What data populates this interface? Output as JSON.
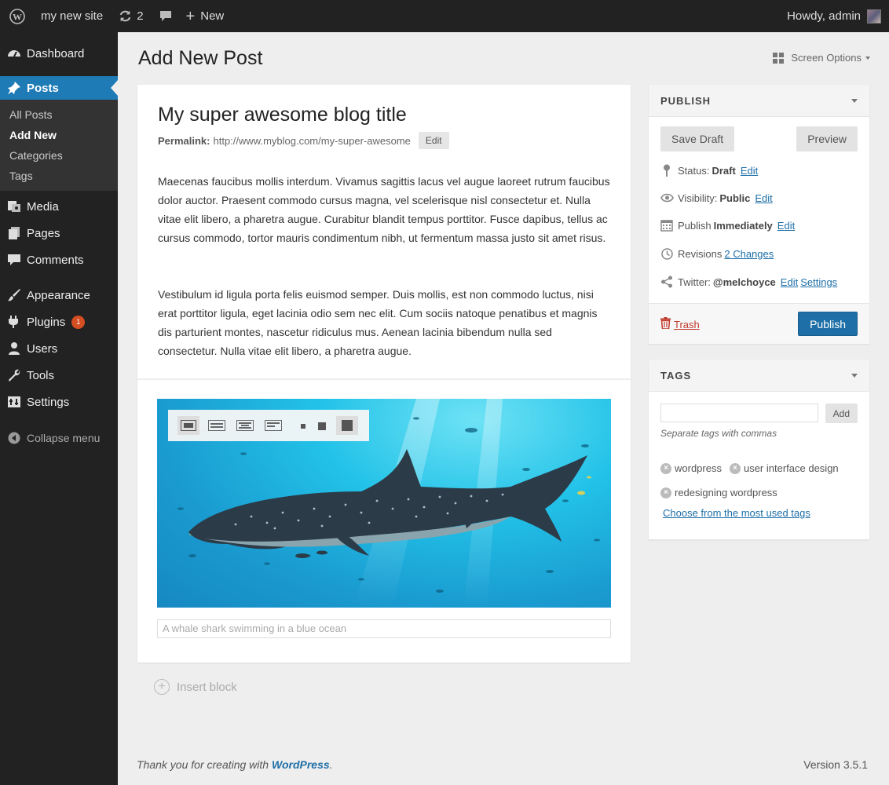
{
  "adminbar": {
    "site_name": "my new site",
    "updates_count": "2",
    "new_label": "New",
    "howdy": "Howdy, admin"
  },
  "sidebar": {
    "items": [
      {
        "label": "Dashboard",
        "icon": "dashboard-icon"
      },
      {
        "label": "Posts",
        "icon": "pin-icon"
      },
      {
        "label": "Media",
        "icon": "media-icon"
      },
      {
        "label": "Pages",
        "icon": "pages-icon"
      },
      {
        "label": "Comments",
        "icon": "comments-icon"
      },
      {
        "label": "Appearance",
        "icon": "brush-icon"
      },
      {
        "label": "Plugins",
        "icon": "plug-icon",
        "badge": "1"
      },
      {
        "label": "Users",
        "icon": "user-icon"
      },
      {
        "label": "Tools",
        "icon": "wrench-icon"
      },
      {
        "label": "Settings",
        "icon": "settings-icon"
      }
    ],
    "submenu": [
      "All Posts",
      "Add New",
      "Categories",
      "Tags"
    ],
    "collapse_label": "Collapse menu"
  },
  "page": {
    "title": "Add New Post",
    "screen_options": "Screen Options"
  },
  "editor": {
    "post_title": "My super awesome blog title",
    "permalink_label": "Permalink:",
    "permalink_url": "http://www.myblog.com/my-super-awesome",
    "edit_label": "Edit",
    "paragraphs": [
      "Maecenas faucibus mollis interdum. Vivamus sagittis lacus vel augue laoreet rutrum faucibus dolor auctor. Praesent commodo cursus magna, vel scelerisque nisl consectetur et. Nulla vitae elit libero, a pharetra augue. Curabitur blandit tempus porttitor. Fusce dapibus, tellus ac cursus commodo, tortor mauris condimentum nibh, ut fermentum massa justo sit amet risus.",
      "Vestibulum id ligula porta felis euismod semper. Duis mollis, est non commodo luctus, nisi erat porttitor ligula, eget lacinia odio sem nec elit. Cum sociis natoque penatibus et magnis dis parturient montes, nascetur ridiculus mus. Aenean lacinia bibendum nulla sed consectetur. Nulla vitae elit libero, a pharetra augue."
    ],
    "image_caption": "A whale shark swimming in a blue ocean",
    "insert_block": "Insert block"
  },
  "publish": {
    "heading": "PUBLISH",
    "save_draft": "Save Draft",
    "preview": "Preview",
    "status_label": "Status:",
    "status_value": "Draft",
    "visibility_label": "Visibility:",
    "visibility_value": "Public",
    "publish_label": "Publish",
    "publish_value": "Immediately",
    "revisions_label": "Revisions",
    "revisions_value": "2 Changes",
    "twitter_label": "Twitter:",
    "twitter_value": "@melchoyce",
    "settings_label": "Settings",
    "edit_label": "Edit",
    "trash": "Trash",
    "publish_button": "Publish"
  },
  "tags": {
    "heading": "TAGS",
    "add_button": "Add",
    "hint": "Separate tags with commas",
    "items": [
      "wordpress",
      "user interface design",
      "redesigning wordpress"
    ],
    "most_used_link": "Choose from the most used tags"
  },
  "footer": {
    "thanks_prefix": "Thank you for creating with",
    "thanks_link": "WordPress",
    "thanks_suffix": ".",
    "version": "Version 3.5.1"
  },
  "colors": {
    "accent": "#1e7bb6",
    "admin_bar": "#222222",
    "badge": "#d54e21",
    "trash": "#c0392b"
  }
}
